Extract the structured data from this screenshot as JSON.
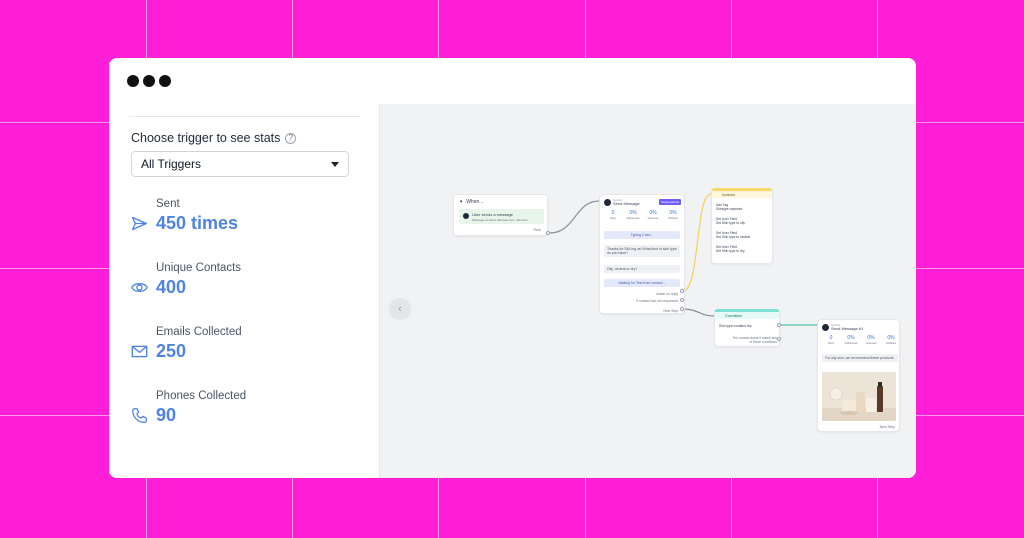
{
  "sidebar": {
    "trigger_title": "Choose trigger to see stats",
    "trigger_select": "All Triggers",
    "stats": [
      {
        "label": "Sent",
        "value": "450 times",
        "icon": "send-icon"
      },
      {
        "label": "Unique Contacts",
        "value": "400",
        "icon": "eye-icon"
      },
      {
        "label": "Emails Collected",
        "value": "250",
        "icon": "mail-icon"
      },
      {
        "label": "Phones Collected",
        "value": "90",
        "icon": "phone-icon"
      }
    ]
  },
  "flow": {
    "when": {
      "title": "When...",
      "trigger": "User sends a message",
      "trigger_sub": "Message contains Skincare tips, Skincare",
      "then": "Then"
    },
    "send_message": {
      "sender": "Sephie",
      "title": "Send Message",
      "badge": "Respondents",
      "stats": [
        {
          "value": "0",
          "label": "Sent"
        },
        {
          "value": "0%",
          "label": "Delivered"
        },
        {
          "value": "0%",
          "label": "Opened"
        },
        {
          "value": "0%",
          "label": "Clicked"
        }
      ],
      "typing": "Typing 2 sec...",
      "message": "Thanks for DM-ing us! What kind of skin type do you have?",
      "options": "Oily, neutral or dry?",
      "waiting": "Waiting for Text from contact...",
      "action_on_reply": "Action on reply",
      "not_responded": "If contact has not responded",
      "next_step": "Next Step"
    },
    "actions": {
      "title": "Actions",
      "items": [
        {
          "l1": "Add Tag",
          "l2": "Skintype captured"
        },
        {
          "l1": "Set User Field",
          "l2": "Set Skin type to oily"
        },
        {
          "l1": "Set User Field",
          "l2": "Set Skin type to neutral"
        },
        {
          "l1": "Set User Field",
          "l2": "Set Skin type to dry"
        }
      ]
    },
    "condition": {
      "title": "Condition",
      "rule": "Skin type contains oily",
      "else": "The contact doesn't match any of these conditions"
    },
    "send_message_2": {
      "sender": "Sephie",
      "title": "Send Message #1",
      "stats": [
        {
          "value": "0",
          "label": "Sent"
        },
        {
          "value": "0%",
          "label": "Delivered"
        },
        {
          "value": "0%",
          "label": "Opened"
        },
        {
          "value": "0%",
          "label": "Clicked"
        }
      ],
      "message": "For oily skin, we recommend these products.",
      "next_step": "Next Step"
    }
  },
  "colors": {
    "background": "#ff1fd8",
    "accent": "#4f83e2",
    "actions_header": "#f8d96a",
    "condition_header": "#7de0d3"
  }
}
